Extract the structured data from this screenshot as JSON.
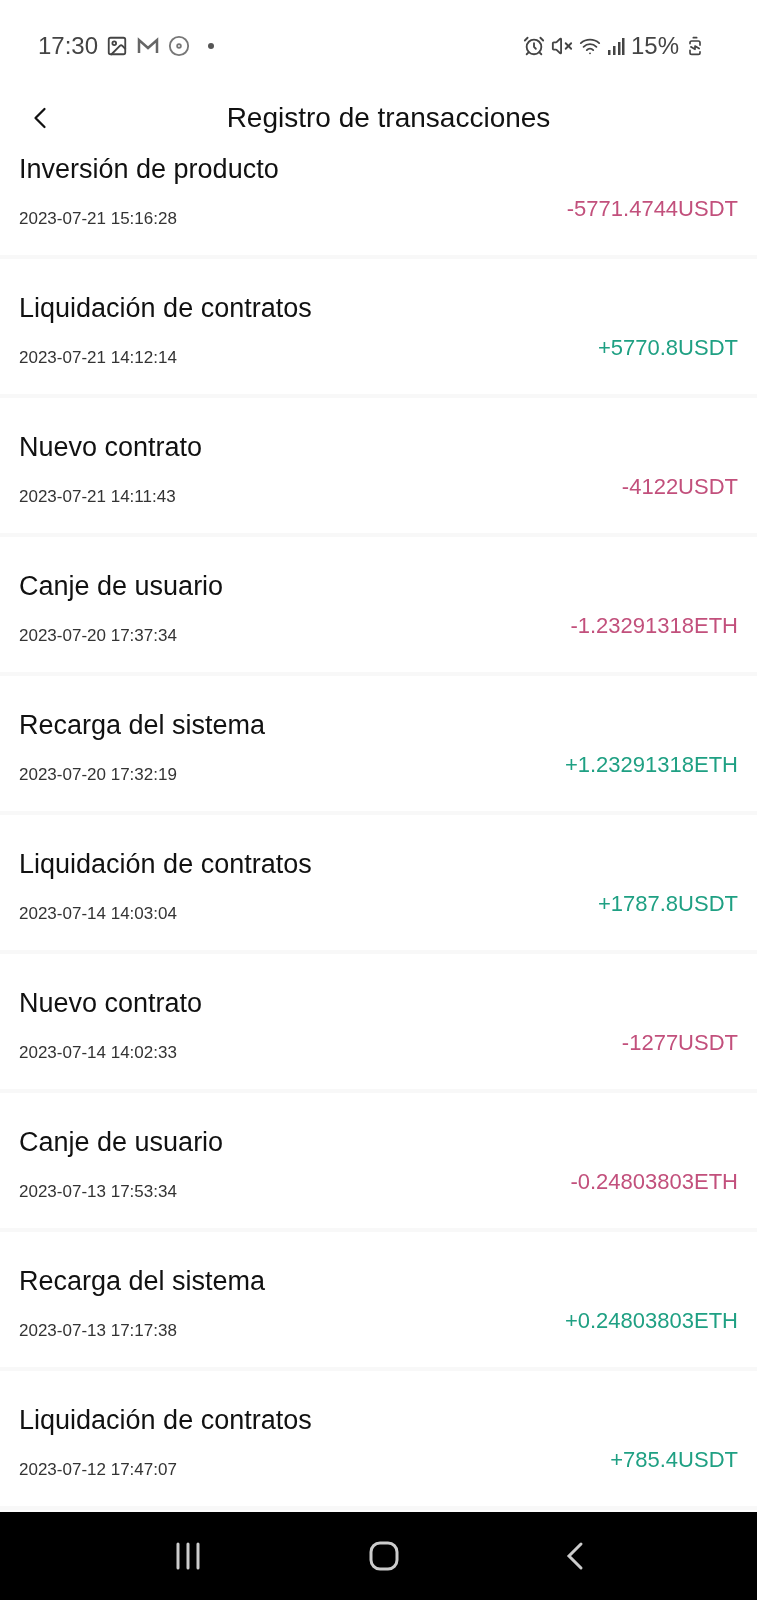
{
  "status_bar": {
    "time": "17:30",
    "battery": "15%"
  },
  "header": {
    "title": "Registro de transacciones"
  },
  "transactions": [
    {
      "title": "Inversión de producto",
      "date": "2023-07-21 15:16:28",
      "amount": "-5771.4744USDT",
      "kind": "debit"
    },
    {
      "title": "Liquidación de contratos",
      "date": "2023-07-21 14:12:14",
      "amount": "+5770.8USDT",
      "kind": "credit"
    },
    {
      "title": "Nuevo contrato",
      "date": "2023-07-21 14:11:43",
      "amount": "-4122USDT",
      "kind": "debit"
    },
    {
      "title": "Canje de usuario",
      "date": "2023-07-20 17:37:34",
      "amount": "-1.23291318ETH",
      "kind": "debit"
    },
    {
      "title": "Recarga del sistema",
      "date": "2023-07-20 17:32:19",
      "amount": "+1.23291318ETH",
      "kind": "credit"
    },
    {
      "title": "Liquidación de contratos",
      "date": "2023-07-14 14:03:04",
      "amount": "+1787.8USDT",
      "kind": "credit"
    },
    {
      "title": "Nuevo contrato",
      "date": "2023-07-14 14:02:33",
      "amount": "-1277USDT",
      "kind": "debit"
    },
    {
      "title": "Canje de usuario",
      "date": "2023-07-13 17:53:34",
      "amount": "-0.24803803ETH",
      "kind": "debit"
    },
    {
      "title": "Recarga del sistema",
      "date": "2023-07-13 17:17:38",
      "amount": "+0.24803803ETH",
      "kind": "credit"
    },
    {
      "title": "Liquidación de contratos",
      "date": "2023-07-12 17:47:07",
      "amount": "+785.4USDT",
      "kind": "credit"
    }
  ]
}
